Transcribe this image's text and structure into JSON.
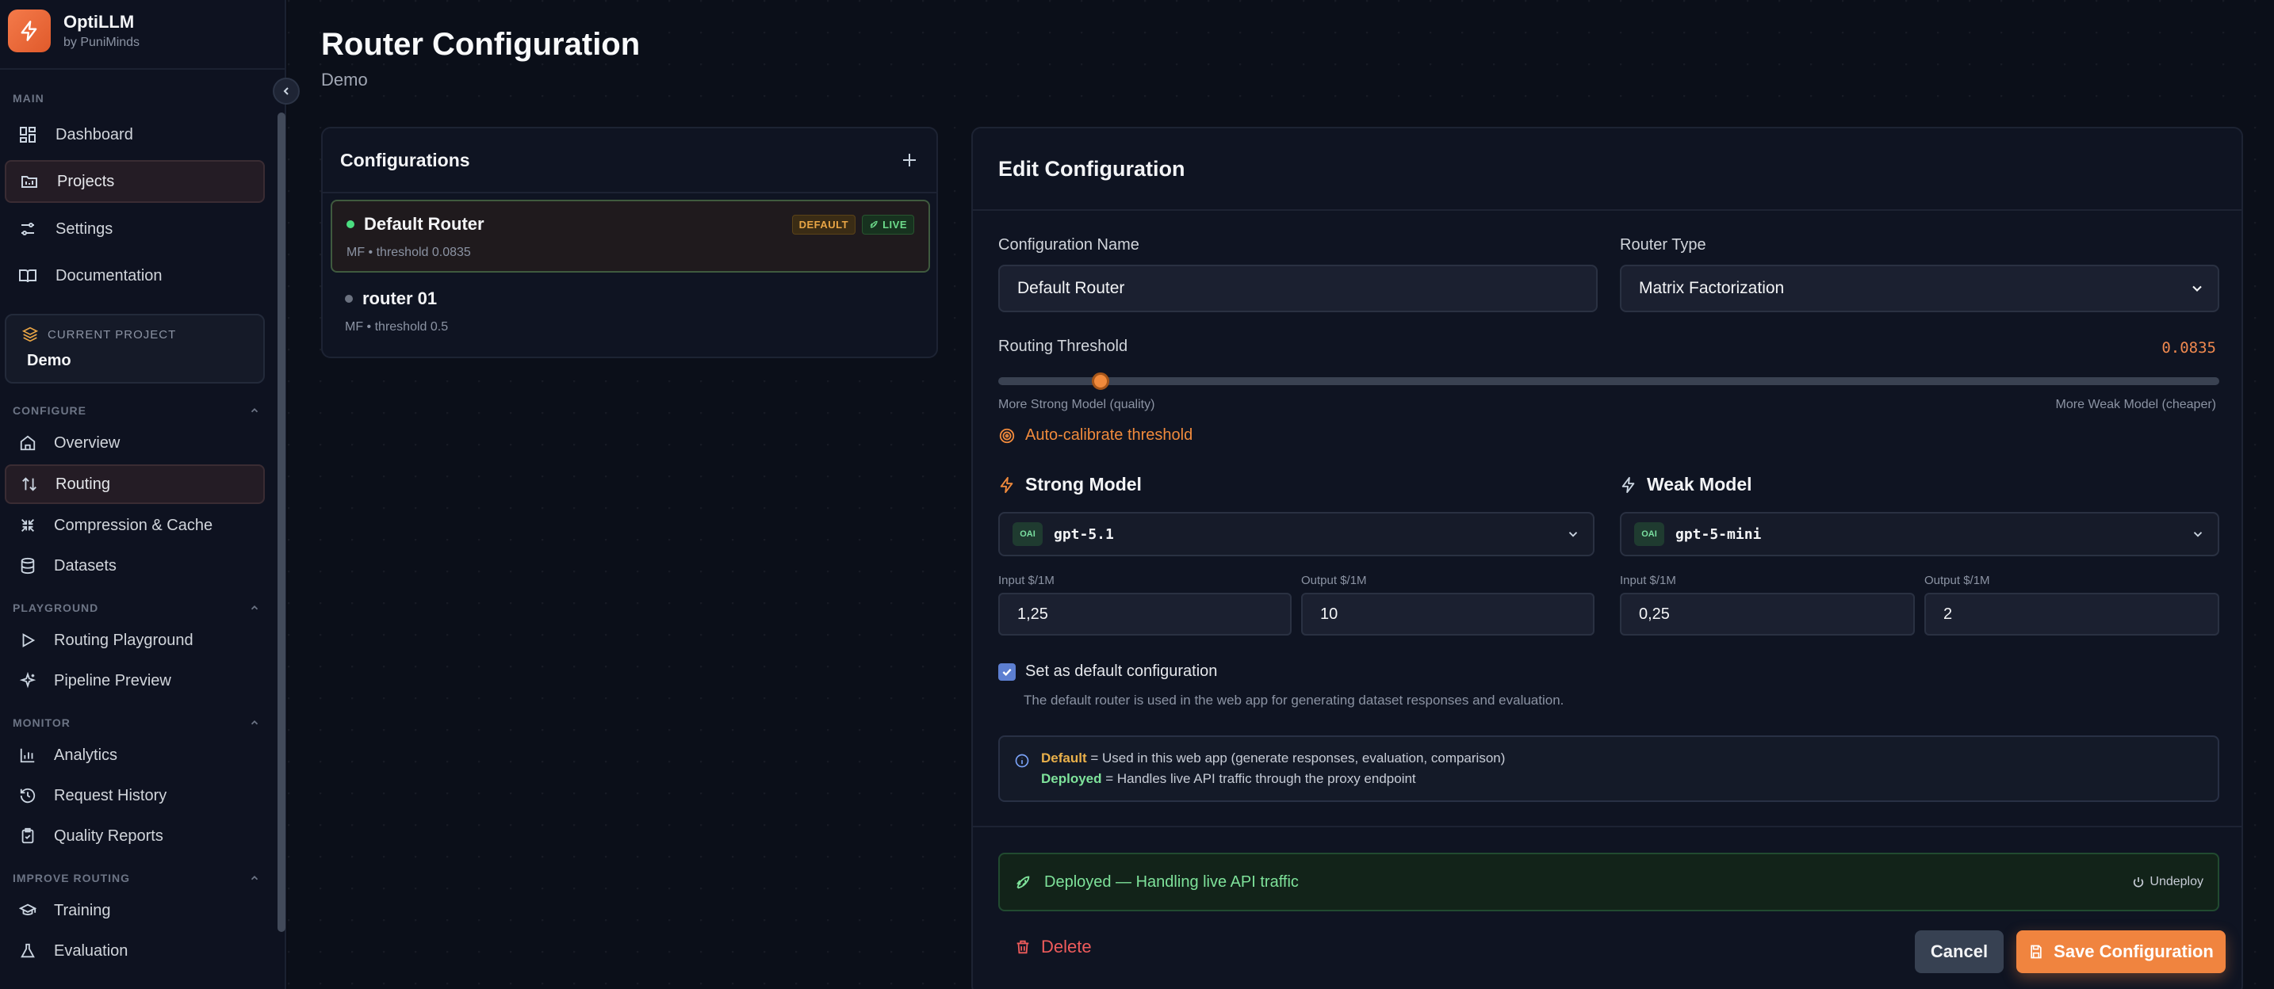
{
  "brand": {
    "name": "OptiLLM",
    "sub": "by PuniMinds"
  },
  "sidebar": {
    "main_label": "MAIN",
    "main_items": [
      {
        "label": "Dashboard",
        "icon": "dashboard-icon"
      },
      {
        "label": "Projects",
        "icon": "projects-icon",
        "active": true
      },
      {
        "label": "Settings",
        "icon": "settings-icon"
      },
      {
        "label": "Documentation",
        "icon": "book-icon"
      }
    ],
    "current_project_label": "CURRENT PROJECT",
    "current_project_name": "Demo",
    "configure_label": "CONFIGURE",
    "configure_items": [
      {
        "label": "Overview",
        "icon": "home-icon"
      },
      {
        "label": "Routing",
        "icon": "routing-icon",
        "active": true
      },
      {
        "label": "Compression & Cache",
        "icon": "compress-icon"
      },
      {
        "label": "Datasets",
        "icon": "database-icon"
      }
    ],
    "playground_label": "PLAYGROUND",
    "playground_items": [
      {
        "label": "Routing Playground",
        "icon": "play-icon"
      },
      {
        "label": "Pipeline Preview",
        "icon": "sparkle-icon"
      }
    ],
    "monitor_label": "MONITOR",
    "monitor_items": [
      {
        "label": "Analytics",
        "icon": "chart-icon"
      },
      {
        "label": "Request History",
        "icon": "history-icon"
      },
      {
        "label": "Quality Reports",
        "icon": "clipboard-icon"
      }
    ],
    "improve_label": "IMPROVE ROUTING",
    "improve_items": [
      {
        "label": "Training",
        "icon": "graduation-icon"
      },
      {
        "label": "Evaluation",
        "icon": "flask-icon"
      }
    ]
  },
  "header": {
    "title": "Router Configuration",
    "subtitle": "Demo"
  },
  "configurations": {
    "title": "Configurations",
    "items": [
      {
        "name": "Default Router",
        "sub": "MF • threshold 0.0835",
        "badge_default": "DEFAULT",
        "badge_live": "LIVE",
        "status_color": "#4ade80"
      },
      {
        "name": "router 01",
        "sub": "MF • threshold 0.5",
        "status_color": "#6b7280"
      }
    ]
  },
  "edit": {
    "title": "Edit Configuration",
    "name_label": "Configuration Name",
    "name_value": "Default Router",
    "type_label": "Router Type",
    "type_value": "Matrix Factorization",
    "threshold_label": "Routing Threshold",
    "threshold_value": "0.0835",
    "threshold_fraction": 0.0835,
    "hint_left": "More Strong Model (quality)",
    "hint_right": "More Weak Model (cheaper)",
    "auto_calibrate": "Auto-calibrate threshold",
    "strong": {
      "title": "Strong Model",
      "provider": "OAI",
      "model": "gpt-5.1",
      "input_label": "Input $/1M",
      "input_value": "1,25",
      "output_label": "Output $/1M",
      "output_value": "10"
    },
    "weak": {
      "title": "Weak Model",
      "provider": "OAI",
      "model": "gpt-5-mini",
      "input_label": "Input $/1M",
      "input_value": "0,25",
      "output_label": "Output $/1M",
      "output_value": "2"
    },
    "default_checkbox": "Set as default configuration",
    "default_help": "The default router is used in the web app for generating dataset responses and evaluation.",
    "info_default_kw": "Default",
    "info_default_text": " = Used in this web app (generate responses, evaluation, comparison)",
    "info_deployed_kw": "Deployed",
    "info_deployed_text": " = Handles live API traffic through the proxy endpoint",
    "deploy_status": "Deployed — Handling live API traffic",
    "undeploy": "Undeploy",
    "delete": "Delete",
    "cancel": "Cancel",
    "save": "Save Configuration"
  },
  "colors": {
    "accent": "#f0843f",
    "success": "#7ee29a",
    "danger": "#ef5b5b"
  }
}
